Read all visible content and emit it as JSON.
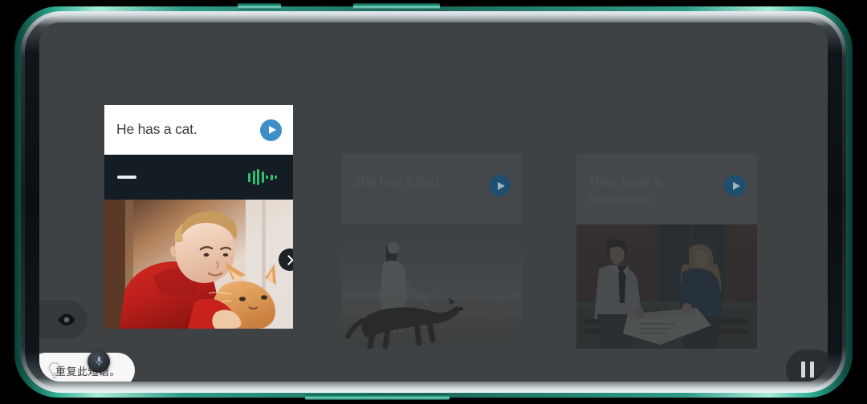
{
  "app": {
    "background_color": "#3f4245",
    "device_frame_color": "#2e9c85"
  },
  "controls": {
    "eye_button": {
      "icon": "eye-icon",
      "label": ""
    },
    "pause_button": {
      "icon": "pause-icon",
      "label": ""
    },
    "next_button": {
      "icon": "chevron-right-icon",
      "label": ""
    },
    "mic_orb": {
      "icon": "microphone-icon",
      "label": ""
    }
  },
  "hint": {
    "text": "重复此短语。",
    "icon": "lightbulb-icon"
  },
  "recording_bar": {
    "state_icon": "dash-icon",
    "waveform_icon": "audio-waveform-icon",
    "waveform_color": "#2fbf6e",
    "waveform_bars": [
      11,
      17,
      20,
      14,
      4,
      7,
      4
    ],
    "background_color": "#141c24"
  },
  "cards": [
    {
      "id": "card-active",
      "title": "He has a cat.",
      "play_icon": "play-icon",
      "play_color": "#3d8ec9",
      "state": "active",
      "image_alt": "boy-in-red-hoodie-holding-orange-cat"
    },
    {
      "id": "card-2",
      "title": "She has a dog.",
      "play_icon": "play-icon",
      "play_color": "#1f4e6e",
      "state": "dimmed",
      "image_alt": "woman-walking-dog-on-beach"
    },
    {
      "id": "card-3",
      "title": "They have a newspaper.",
      "play_icon": "play-icon",
      "play_color": "#1f4e6e",
      "state": "dimmed",
      "image_alt": "man-and-woman-on-bench-with-newspaper"
    }
  ]
}
